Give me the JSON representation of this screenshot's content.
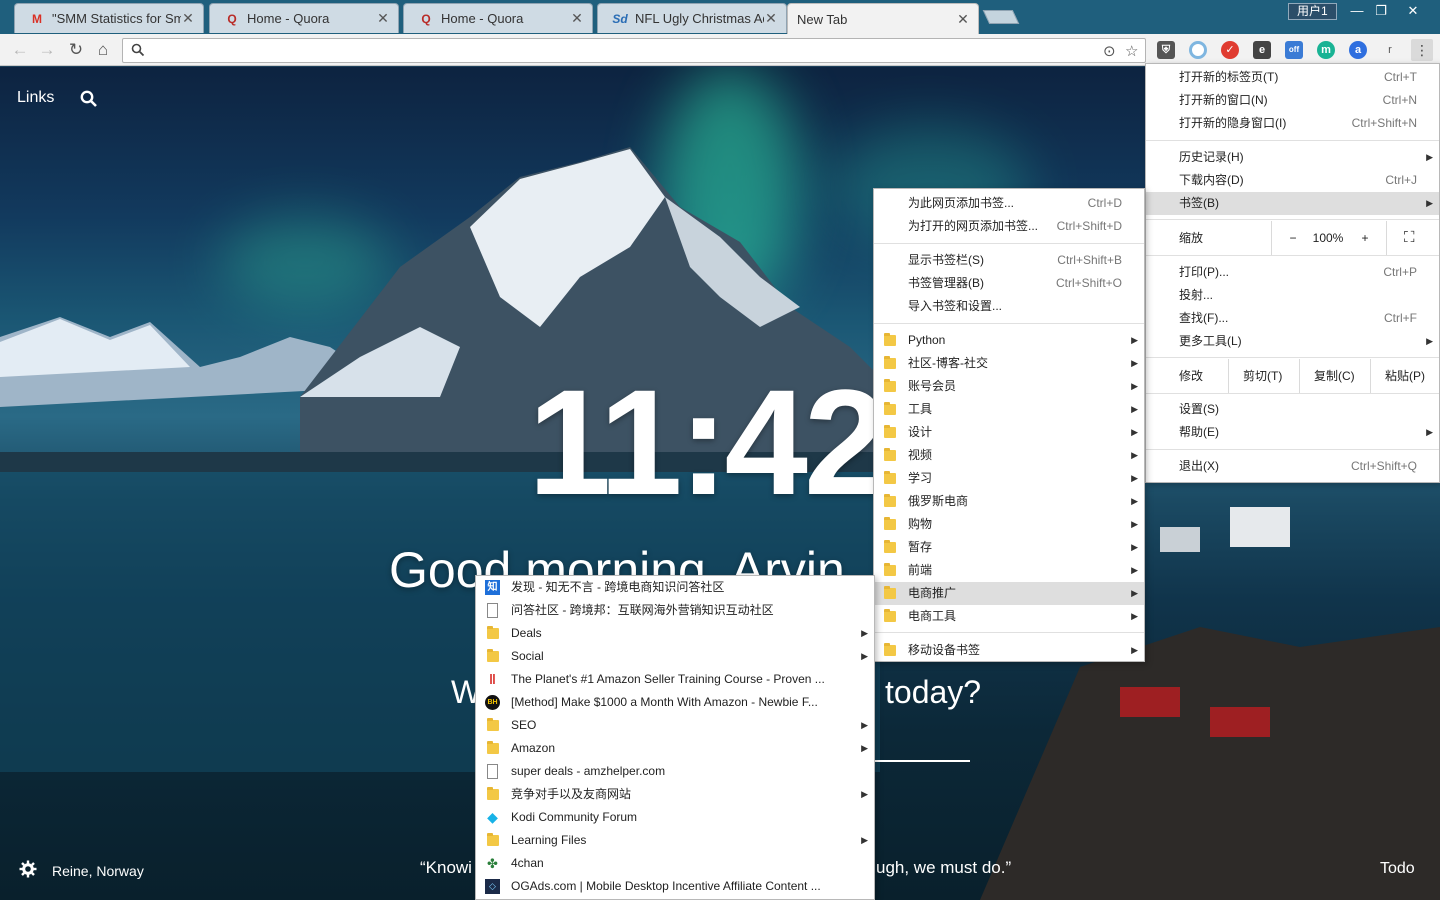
{
  "browser": {
    "tabs": [
      {
        "title": "\"SMM Statistics for Sm",
        "favicon": "gmail-icon"
      },
      {
        "title": "Home - Quora",
        "favicon": "quora-icon"
      },
      {
        "title": "Home - Quora",
        "favicon": "quora-icon"
      },
      {
        "title": "NFL Ugly Christmas Ad",
        "favicon": "sd-icon"
      },
      {
        "title": "New Tab",
        "favicon": "none"
      }
    ],
    "user_badge": "用户1",
    "omnibox_value": ""
  },
  "momentum": {
    "links": "Links",
    "clock": "11:42",
    "greeting": "Good morning, Arvin",
    "focus_q_left": "W",
    "focus_q_right": "today?",
    "location": "Reine, Norway",
    "quote_left": "“Knowi",
    "quote_right": "ugh, we must do.”",
    "todo": "Todo"
  },
  "chrome_menu": {
    "items": [
      {
        "label": "打开新的标签页(T)",
        "shortcut": "Ctrl+T"
      },
      {
        "label": "打开新的窗口(N)",
        "shortcut": "Ctrl+N"
      },
      {
        "label": "打开新的隐身窗口(I)",
        "shortcut": "Ctrl+Shift+N"
      },
      {
        "label": "历史记录(H)",
        "shortcut": ""
      },
      {
        "label": "下载内容(D)",
        "shortcut": "Ctrl+J"
      },
      {
        "label": "书签(B)",
        "shortcut": ""
      },
      {
        "label": "打印(P)...",
        "shortcut": "Ctrl+P"
      },
      {
        "label": "投射...",
        "shortcut": ""
      },
      {
        "label": "查找(F)...",
        "shortcut": "Ctrl+F"
      },
      {
        "label": "更多工具(L)",
        "shortcut": ""
      },
      {
        "label": "设置(S)",
        "shortcut": ""
      },
      {
        "label": "帮助(E)",
        "shortcut": ""
      },
      {
        "label": "退出(X)",
        "shortcut": "Ctrl+Shift+Q"
      }
    ],
    "zoom": {
      "label": "缩放",
      "minus": "−",
      "value": "100%",
      "plus": "+"
    },
    "edit": {
      "label": "修改",
      "cut": "剪切(T)",
      "copy": "复制(C)",
      "paste": "粘贴(P)"
    }
  },
  "bookmarks_menu": {
    "actions": [
      {
        "label": "为此网页添加书签...",
        "shortcut": "Ctrl+D"
      },
      {
        "label": "为打开的网页添加书签...",
        "shortcut": "Ctrl+Shift+D"
      },
      {
        "label": "显示书签栏(S)",
        "shortcut": "Ctrl+Shift+B"
      },
      {
        "label": "书签管理器(B)",
        "shortcut": "Ctrl+Shift+O"
      },
      {
        "label": "导入书签和设置...",
        "shortcut": ""
      }
    ],
    "folders": [
      "Python",
      "社区-博客-社交",
      "账号会员",
      "工具",
      "设计",
      "视频",
      "学习",
      "俄罗斯电商",
      "购物",
      "暂存",
      "前端",
      "电商推广",
      "电商工具"
    ],
    "mobile": "移动设备书签"
  },
  "ecommerce_submenu": {
    "items": [
      {
        "label": "发现 - 知无不言 - 跨境电商知识问答社区",
        "icon": "zhi-icon",
        "folder": false
      },
      {
        "label": "问答社区 - 跨境邦：互联网海外营销知识互动社区",
        "icon": "page-icon",
        "folder": false
      },
      {
        "label": "Deals",
        "icon": "folder-icon",
        "folder": true
      },
      {
        "label": "Social",
        "icon": "folder-icon",
        "folder": true
      },
      {
        "label": "The Planet's #1 Amazon Seller Training Course - Proven ...",
        "icon": "pause-red-icon",
        "folder": false
      },
      {
        "label": "[Method] Make $1000 a Month With Amazon - Newbie F...",
        "icon": "bh-icon",
        "folder": false
      },
      {
        "label": "SEO",
        "icon": "folder-icon",
        "folder": true
      },
      {
        "label": "Amazon",
        "icon": "folder-icon",
        "folder": true
      },
      {
        "label": "super deals - amzhelper.com",
        "icon": "page-icon",
        "folder": false
      },
      {
        "label": "竞争对手以及友商网站",
        "icon": "folder-icon",
        "folder": true
      },
      {
        "label": "Kodi Community Forum",
        "icon": "kodi-icon",
        "folder": false
      },
      {
        "label": "Learning Files",
        "icon": "folder-icon",
        "folder": true
      },
      {
        "label": "4chan",
        "icon": "clover-icon",
        "folder": false
      },
      {
        "label": "OGAds.com | Mobile  Desktop Incentive Affiliate Content ...",
        "icon": "diamond-icon",
        "folder": false
      }
    ]
  }
}
